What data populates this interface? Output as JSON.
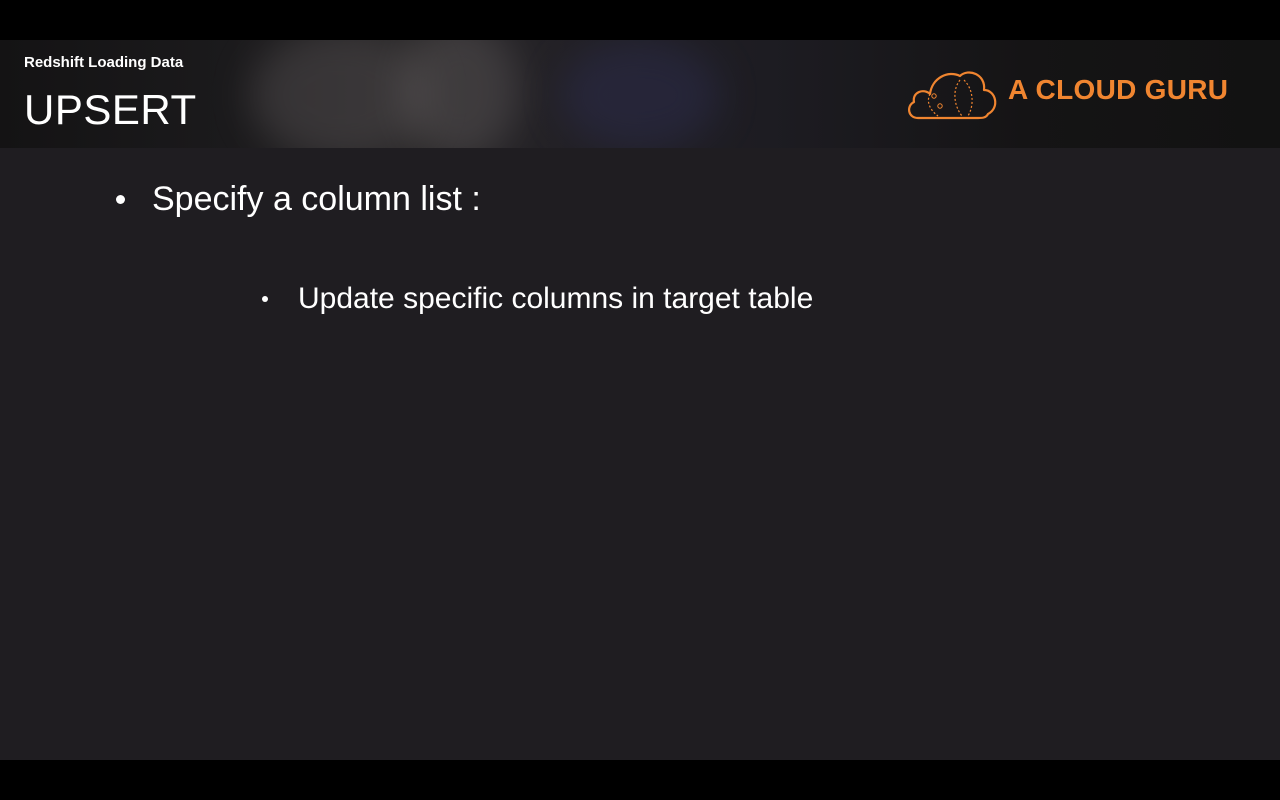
{
  "header": {
    "subtitle": "Redshift Loading Data",
    "title": "UPSERT",
    "logo_text": "A CLOUD GURU"
  },
  "bullets": {
    "level1": "Specify a column list :",
    "level2": "Update specific columns in target table"
  },
  "colors": {
    "brand_orange": "#f08530",
    "slide_background": "#1f1d21",
    "text": "#ffffff"
  },
  "icons": {
    "logo": "cloud-logo-icon",
    "bullet": "bullet-dot-icon"
  }
}
